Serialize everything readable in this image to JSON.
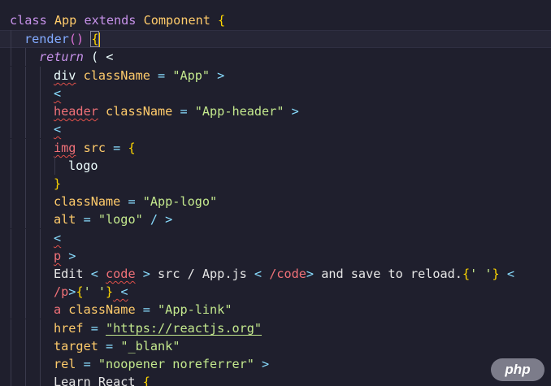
{
  "editor": {
    "lines": [
      {
        "t1": "class",
        "t2": " App ",
        "t3": "extends",
        "t4": " Component ",
        "t5": "{"
      },
      {
        "t1": "render",
        "t2": "()",
        "t3": "{"
      },
      {
        "t1": "return",
        "t2": " ( <"
      },
      {
        "t1": "div",
        "t2": " className",
        "t3": " = ",
        "t4": "\"App\"",
        "t5": " >"
      },
      {
        "t1": "<"
      },
      {
        "t1": "header",
        "t2": " className",
        "t3": " = ",
        "t4": "\"App-header\"",
        "t5": " >"
      },
      {
        "t1": "<"
      },
      {
        "t1": "img",
        "t2": " src",
        "t3": " = ",
        "t4": "{"
      },
      {
        "t1": "logo"
      },
      {
        "t1": "}"
      },
      {
        "t1": "className",
        "t2": " = ",
        "t3": "\"App-logo\""
      },
      {
        "t1": "alt",
        "t2": " = ",
        "t3": "\"logo\"",
        "t4": " / >"
      },
      {
        "t1": "<"
      },
      {
        "t1": "p",
        "t2": " >"
      },
      {
        "t1": "Edit",
        "t2": " < ",
        "t3": "code",
        "t4": " > ",
        "t5": "src / App.js",
        "t6": " < ",
        "t7": "/code",
        "t8": "> ",
        "t9": "and save to reload.",
        "t10": "{",
        "t11": "' '",
        "t12": "}",
        "t13": " <"
      },
      {
        "t1": "/p",
        "t2": ">",
        "t3": "{",
        "t4": "' '",
        "t5": "}",
        "t6": " <"
      },
      {
        "t1": "a",
        "t2": " className",
        "t3": " = ",
        "t4": "\"App-link\""
      },
      {
        "t1": "href",
        "t2": " = ",
        "t3": "\"https://reactjs.org\""
      },
      {
        "t1": "target",
        "t2": " = ",
        "t3": "\"_blank\""
      },
      {
        "t1": "rel",
        "t2": " = ",
        "t3": "\"noopener noreferrer\"",
        "t4": " >"
      },
      {
        "t1": "Learn React",
        "t2": " {"
      }
    ]
  },
  "watermark": {
    "text": "php"
  }
}
